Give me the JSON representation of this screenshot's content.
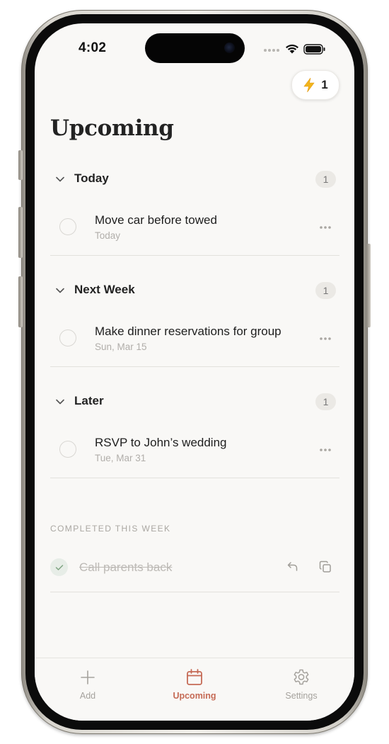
{
  "status_bar": {
    "time": "4:02"
  },
  "header": {
    "streak_count": "1",
    "streak_icon": "lightning-bolt-icon",
    "title": "Upcoming"
  },
  "sections": [
    {
      "title": "Today",
      "count": "1",
      "tasks": [
        {
          "title": "Move car before towed",
          "date": "Today"
        }
      ]
    },
    {
      "title": "Next Week",
      "count": "1",
      "tasks": [
        {
          "title": "Make dinner reservations for group",
          "date": "Sun, Mar 15"
        }
      ]
    },
    {
      "title": "Later",
      "count": "1",
      "tasks": [
        {
          "title": "RSVP to John’s wedding",
          "date": "Tue, Mar 31"
        }
      ]
    }
  ],
  "completed": {
    "label": "COMPLETED THIS WEEK",
    "tasks": [
      {
        "title": "Call parents back"
      }
    ]
  },
  "tabbar": {
    "tabs": [
      {
        "label": "Add",
        "icon": "plus-icon",
        "active": false
      },
      {
        "label": "Upcoming",
        "icon": "calendar-icon",
        "active": true
      },
      {
        "label": "Settings",
        "icon": "gear-icon",
        "active": false
      }
    ]
  },
  "colors": {
    "accent": "#c56a55",
    "background": "#f9f8f6",
    "bolt": "#f2b51c"
  }
}
